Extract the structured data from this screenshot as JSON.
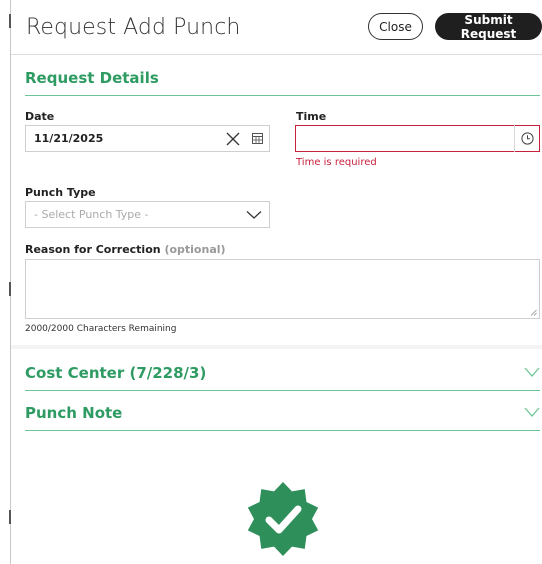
{
  "header": {
    "title": "Request Add Punch",
    "close_label": "Close",
    "submit_label": "Submit Request"
  },
  "request_details": {
    "heading": "Request Details",
    "date": {
      "label": "Date",
      "value": "11/21/2025"
    },
    "time": {
      "label": "Time",
      "value": "",
      "error": "Time is required"
    },
    "punch_type": {
      "label": "Punch Type",
      "placeholder": "- Select Punch Type -"
    },
    "reason": {
      "label": "Reason for Correction",
      "optional": "(optional)",
      "counter": "2000/2000 Characters Remaining"
    }
  },
  "cost_center": {
    "heading": "Cost Center (7/228/3)"
  },
  "punch_note": {
    "heading": "Punch Note"
  },
  "colors": {
    "accent_green": "#2e9b62",
    "error_red": "#c8203c",
    "badge_green": "#2f8f5b"
  },
  "icons": [
    "clear-icon",
    "calendar-icon",
    "clock-icon",
    "chevron-down-icon",
    "verified-badge-icon"
  ]
}
